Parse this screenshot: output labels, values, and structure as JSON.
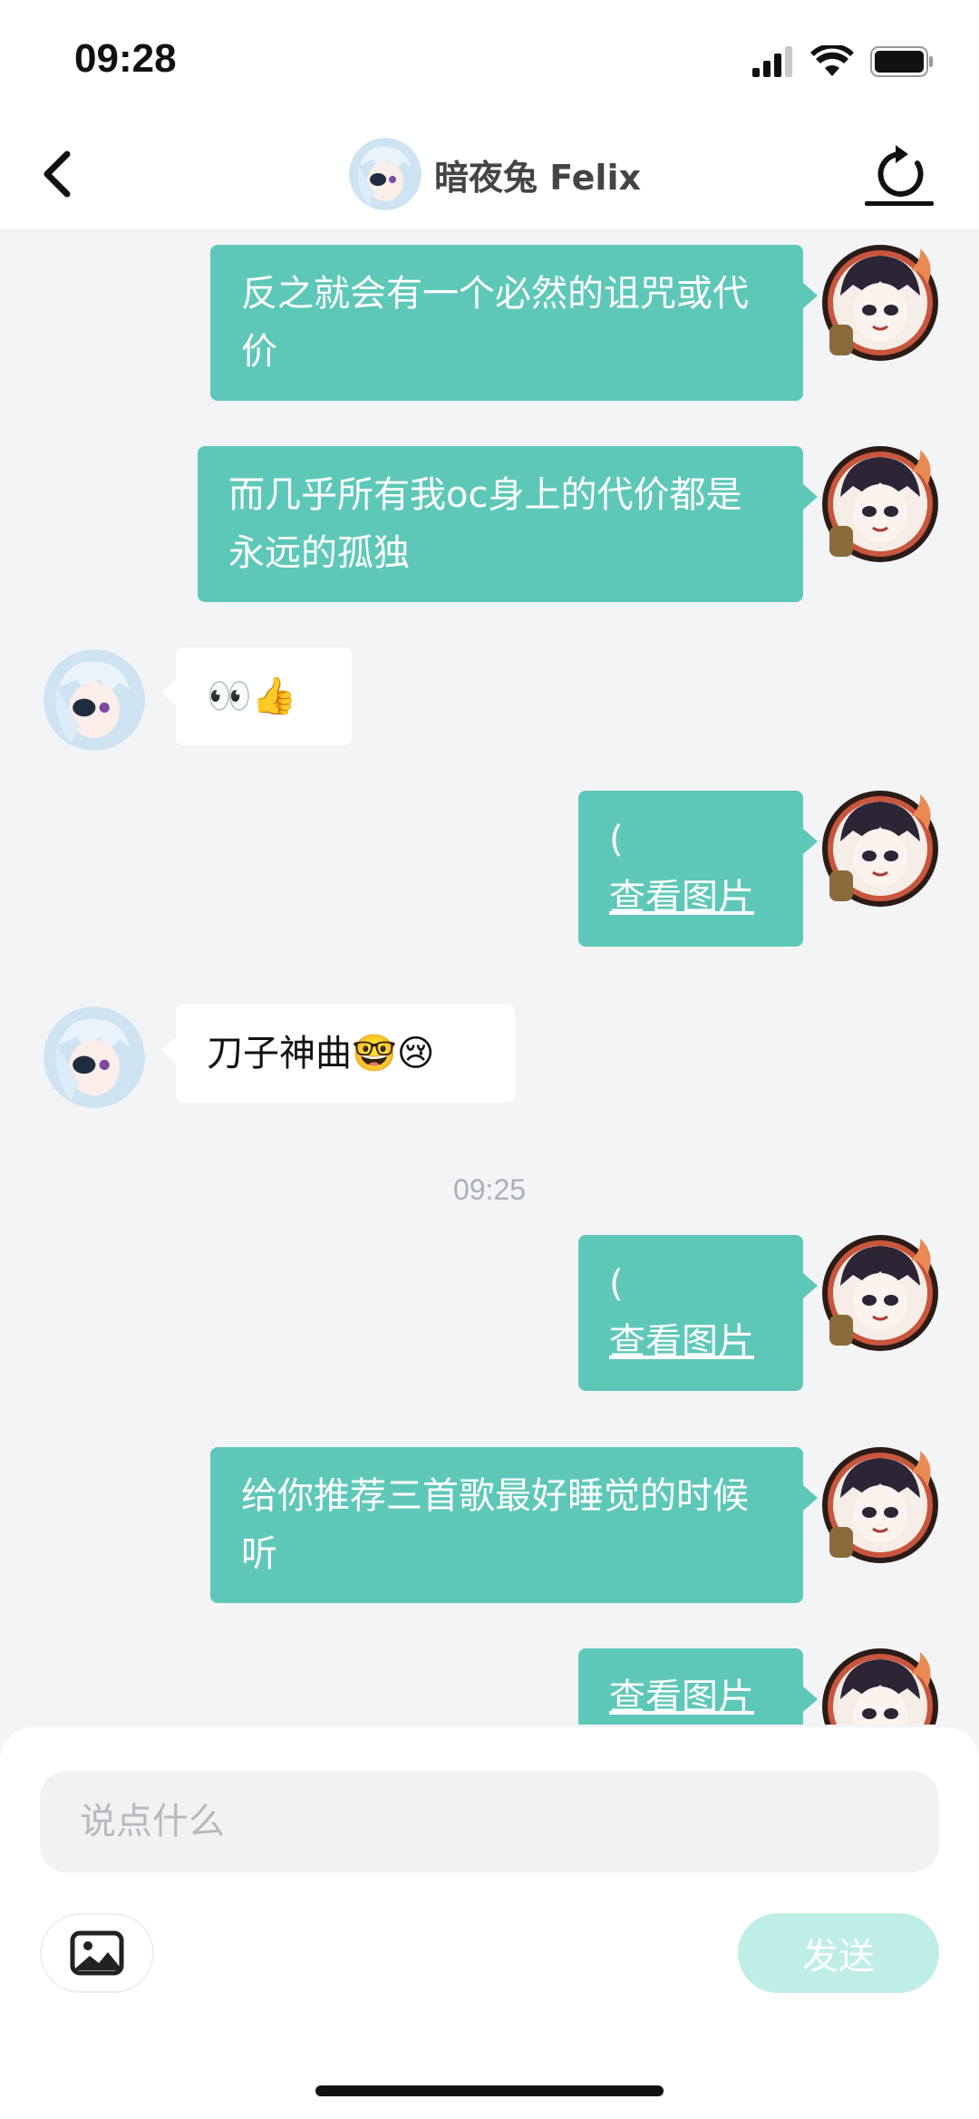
{
  "status_bar": {
    "time": "09:28"
  },
  "header": {
    "title": "暗夜兔 Felix"
  },
  "messages": [
    {
      "side": "out",
      "text": "反之就会有一个必然的诅咒或代价"
    },
    {
      "side": "out",
      "text": "而几乎所有我oc身上的代价都是永远的孤独"
    },
    {
      "side": "in",
      "text": "👀👍"
    },
    {
      "side": "out",
      "text": "(",
      "link": "查看图片"
    },
    {
      "side": "in",
      "text": "刀子神曲🤓😢"
    },
    {
      "side": "timestamp",
      "text": "09:25"
    },
    {
      "side": "out",
      "text": "(",
      "link": "查看图片"
    },
    {
      "side": "out",
      "text": "给你推荐三首歌最好睡觉的时候听"
    },
    {
      "side": "out",
      "link": "查看图片"
    }
  ],
  "composer": {
    "placeholder": "说点什么",
    "send_label": "发送"
  },
  "colors": {
    "accent": "#5ec8b8",
    "send_disabled": "#bfeee6"
  }
}
